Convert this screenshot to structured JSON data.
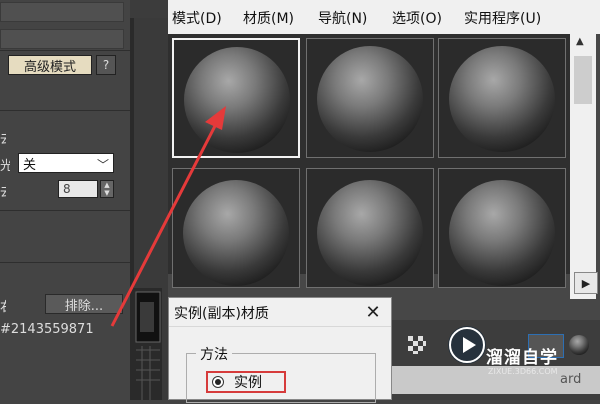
{
  "left_panel": {
    "advanced_mode_button": "高级模式",
    "help_button": "?",
    "label_cut_1": "去",
    "label_cut_2": "光",
    "select_value": "关",
    "label_cut_3": "去",
    "spinner_value": "8",
    "label_cut_4": "右",
    "exclude_button": "排除...",
    "object_id": "#2143559871"
  },
  "menubar": {
    "items": [
      "模式(D)",
      "材质(M)",
      "导航(N)",
      "选项(O)",
      "实用程序(U)"
    ]
  },
  "material_slots": {
    "active_index": 0,
    "count": 6
  },
  "dialog": {
    "title": "实例(副本)材质",
    "close": "✕",
    "group_label": "方法",
    "option_instance": "实例"
  },
  "scroll": {
    "up": "▲",
    "down": "▼",
    "right": "▶"
  },
  "name_field_fragment": "ard",
  "watermark": {
    "title": "溜溜自学",
    "subtitle": "ZIXUE.3D66.COM"
  },
  "colors": {
    "annotation_red": "#e53a3a",
    "accent_button": "#e6dcc0",
    "menubar_bg": "#f0f0f0"
  }
}
